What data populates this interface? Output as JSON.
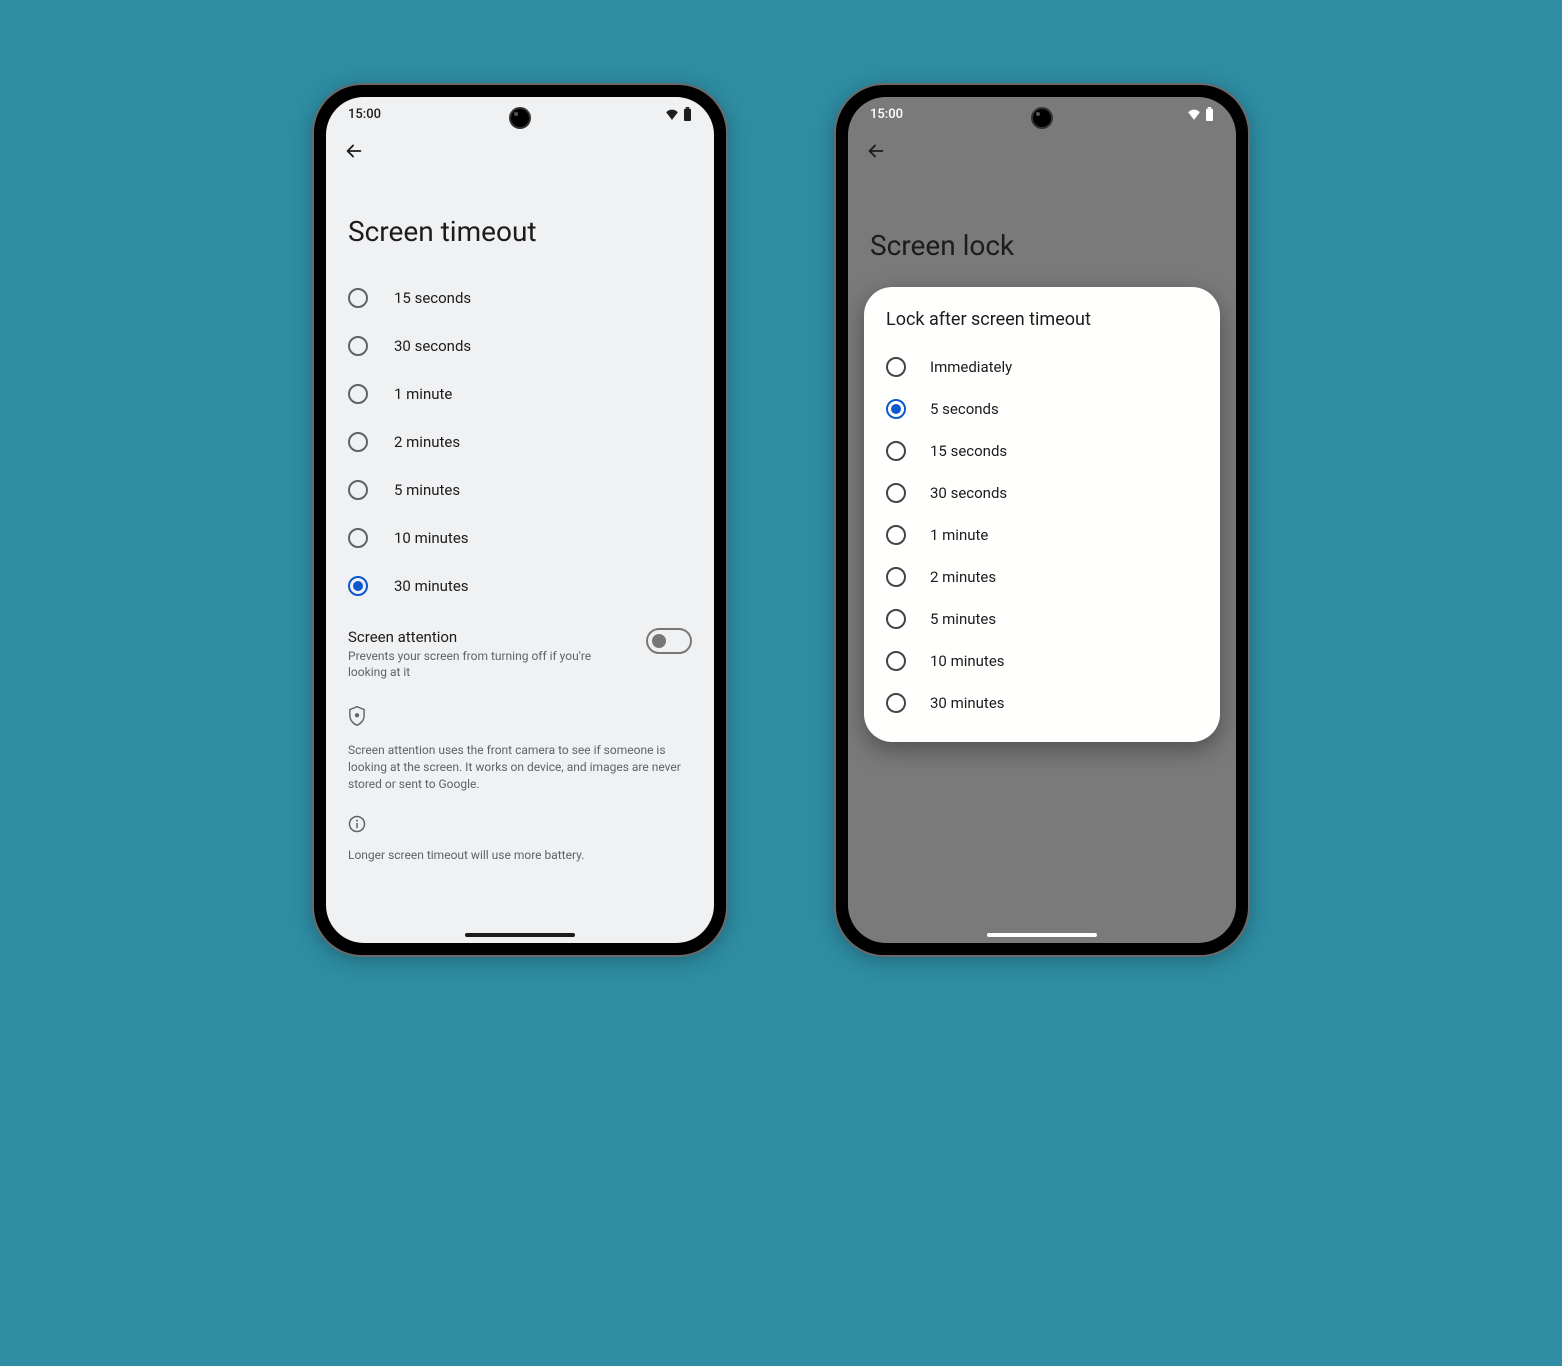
{
  "status": {
    "time": "15:00"
  },
  "phone1": {
    "title": "Screen timeout",
    "options": [
      {
        "label": "15 seconds",
        "selected": false
      },
      {
        "label": "30 seconds",
        "selected": false
      },
      {
        "label": "1 minute",
        "selected": false
      },
      {
        "label": "2 minutes",
        "selected": false
      },
      {
        "label": "5 minutes",
        "selected": false
      },
      {
        "label": "10 minutes",
        "selected": false
      },
      {
        "label": "30 minutes",
        "selected": true
      }
    ],
    "attention": {
      "title": "Screen attention",
      "subtitle": "Prevents your screen from turning off if you're looking at it",
      "enabled": false
    },
    "privacy_text": "Screen attention uses the front camera to see if someone is looking at the screen. It works on device, and images are never stored or sent to Google.",
    "footer_text": "Longer screen timeout will use more battery."
  },
  "phone2": {
    "title": "Screen lock",
    "dialog": {
      "title": "Lock after screen timeout",
      "options": [
        {
          "label": "Immediately",
          "selected": false
        },
        {
          "label": "5 seconds",
          "selected": true
        },
        {
          "label": "15 seconds",
          "selected": false
        },
        {
          "label": "30 seconds",
          "selected": false
        },
        {
          "label": "1 minute",
          "selected": false
        },
        {
          "label": "2 minutes",
          "selected": false
        },
        {
          "label": "5 minutes",
          "selected": false
        },
        {
          "label": "10 minutes",
          "selected": false
        },
        {
          "label": "30 minutes",
          "selected": false
        }
      ]
    }
  }
}
